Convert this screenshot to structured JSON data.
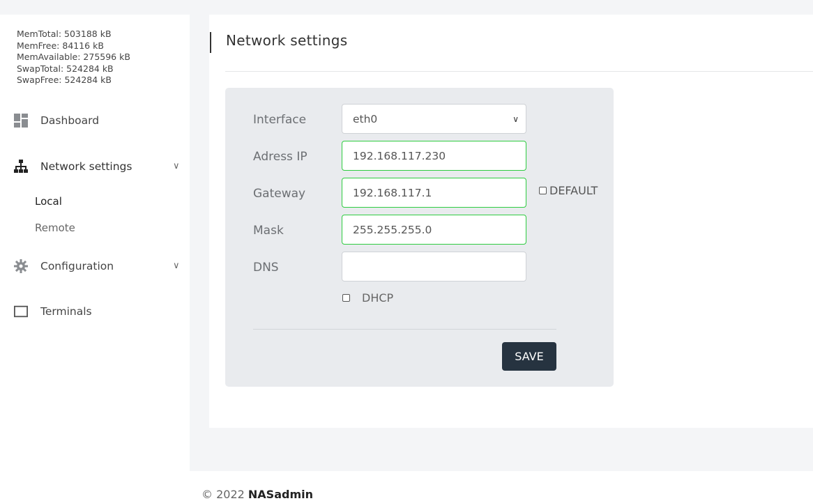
{
  "meminfo": {
    "mem_total": "MemTotal: 503188 kB",
    "mem_free": "MemFree: 84116 kB",
    "mem_available": "MemAvailable: 275596 kB",
    "swap_total": "SwapTotal: 524284 kB",
    "swap_free": "SwapFree: 524284 kB"
  },
  "sidebar": {
    "items": [
      {
        "label": "Dashboard",
        "icon": "dashboard-icon"
      },
      {
        "label": "Network settings",
        "icon": "network-icon",
        "expanded": true,
        "children": [
          {
            "label": "Local",
            "active": true
          },
          {
            "label": "Remote"
          }
        ]
      },
      {
        "label": "Configuration",
        "icon": "gear-icon"
      },
      {
        "label": "Terminals",
        "icon": "terminal-icon"
      }
    ]
  },
  "page": {
    "title": "Network settings"
  },
  "form": {
    "interface_label": "Interface",
    "interface_value": "eth0",
    "ip_label": "Adress IP",
    "ip_value": "192.168.117.230",
    "gateway_label": "Gateway",
    "gateway_value": "192.168.117.1",
    "default_label": "DEFAULT",
    "mask_label": "Mask",
    "mask_value": "255.255.255.0",
    "dns_label": "DNS",
    "dns_value": "",
    "dhcp_label": "DHCP",
    "save_label": "SAVE"
  },
  "footer": {
    "copyright": "© 2022",
    "brand": "NASadmin"
  },
  "colors": {
    "accent_dark": "#263340",
    "valid_border": "#2ecc40",
    "panel_bg": "#e9ebee"
  }
}
